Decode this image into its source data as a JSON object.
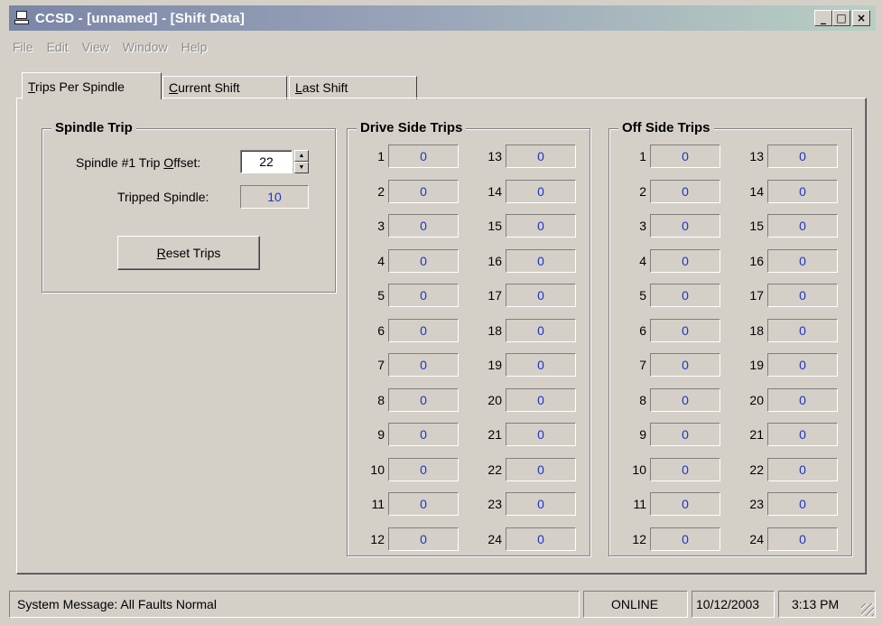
{
  "window": {
    "title": "CCSD - [unnamed] - [Shift Data]",
    "minimize_glyph": "_",
    "maximize_glyph": "□",
    "close_glyph": "×"
  },
  "menu": [
    "File",
    "Edit",
    "View",
    "Window",
    "Help"
  ],
  "tabs": [
    {
      "first": "T",
      "rest": "rips Per Spindle"
    },
    {
      "first": "C",
      "rest": "urrent Shift"
    },
    {
      "first": "L",
      "rest": "ast Shift"
    }
  ],
  "spindle_trip": {
    "title": "Spindle Trip",
    "offset_label_pre": "Spindle #1 Trip ",
    "offset_label_key": "O",
    "offset_label_post": "ffset:",
    "offset_value": "22",
    "tripped_label": "Tripped Spindle:",
    "tripped_value": "10",
    "reset_key": "R",
    "reset_rest": "eset Trips"
  },
  "drive_side": {
    "title": "Drive Side Trips",
    "left": [
      {
        "n": "1",
        "v": "0"
      },
      {
        "n": "2",
        "v": "0"
      },
      {
        "n": "3",
        "v": "0"
      },
      {
        "n": "4",
        "v": "0"
      },
      {
        "n": "5",
        "v": "0"
      },
      {
        "n": "6",
        "v": "0"
      },
      {
        "n": "7",
        "v": "0"
      },
      {
        "n": "8",
        "v": "0"
      },
      {
        "n": "9",
        "v": "0"
      },
      {
        "n": "10",
        "v": "0"
      },
      {
        "n": "11",
        "v": "0"
      },
      {
        "n": "12",
        "v": "0"
      }
    ],
    "right": [
      {
        "n": "13",
        "v": "0"
      },
      {
        "n": "14",
        "v": "0"
      },
      {
        "n": "15",
        "v": "0"
      },
      {
        "n": "16",
        "v": "0"
      },
      {
        "n": "17",
        "v": "0"
      },
      {
        "n": "18",
        "v": "0"
      },
      {
        "n": "19",
        "v": "0"
      },
      {
        "n": "20",
        "v": "0"
      },
      {
        "n": "21",
        "v": "0"
      },
      {
        "n": "22",
        "v": "0"
      },
      {
        "n": "23",
        "v": "0"
      },
      {
        "n": "24",
        "v": "0"
      }
    ]
  },
  "off_side": {
    "title": "Off Side Trips",
    "left": [
      {
        "n": "1",
        "v": "0"
      },
      {
        "n": "2",
        "v": "0"
      },
      {
        "n": "3",
        "v": "0"
      },
      {
        "n": "4",
        "v": "0"
      },
      {
        "n": "5",
        "v": "0"
      },
      {
        "n": "6",
        "v": "0"
      },
      {
        "n": "7",
        "v": "0"
      },
      {
        "n": "8",
        "v": "0"
      },
      {
        "n": "9",
        "v": "0"
      },
      {
        "n": "10",
        "v": "0"
      },
      {
        "n": "11",
        "v": "0"
      },
      {
        "n": "12",
        "v": "0"
      }
    ],
    "right": [
      {
        "n": "13",
        "v": "0"
      },
      {
        "n": "14",
        "v": "0"
      },
      {
        "n": "15",
        "v": "0"
      },
      {
        "n": "16",
        "v": "0"
      },
      {
        "n": "17",
        "v": "0"
      },
      {
        "n": "18",
        "v": "0"
      },
      {
        "n": "19",
        "v": "0"
      },
      {
        "n": "20",
        "v": "0"
      },
      {
        "n": "21",
        "v": "0"
      },
      {
        "n": "22",
        "v": "0"
      },
      {
        "n": "23",
        "v": "0"
      },
      {
        "n": "24",
        "v": "0"
      }
    ]
  },
  "status": {
    "message": "System Message:  All Faults Normal",
    "connection": "ONLINE",
    "date": "10/12/2003",
    "time": "3:13 PM"
  },
  "icons": {
    "app": "computer-icon",
    "spin_up": "▲",
    "spin_down": "▼"
  },
  "colors": {
    "value_text": "#1f33c8",
    "title_start": "#7a86a6",
    "title_end": "#b9cfc3"
  }
}
